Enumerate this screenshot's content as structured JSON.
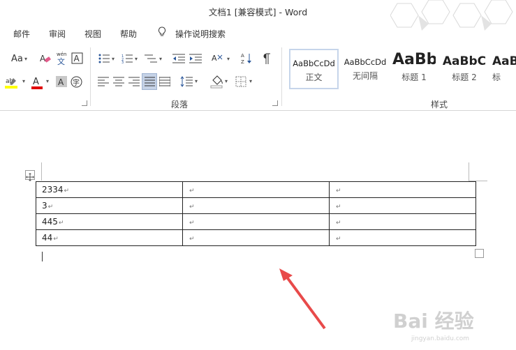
{
  "window": {
    "title": "文档1 [兼容模式]  -  Word"
  },
  "tabs": [
    {
      "label": "邮件"
    },
    {
      "label": "审阅"
    },
    {
      "label": "视图"
    },
    {
      "label": "帮助"
    }
  ],
  "tell_me": {
    "label": "操作说明搜索"
  },
  "ribbon": {
    "font_size_btn": "Aa",
    "paragraph_group": "段落",
    "styles_group": "样式",
    "styles": [
      {
        "sample": "AaBbCcDd",
        "name": "正文",
        "selected": true
      },
      {
        "sample": "AaBbCcDd",
        "name": "无间隔",
        "selected": false
      },
      {
        "sample": "AaBb",
        "name": "标题 1",
        "selected": false
      },
      {
        "sample": "AaBbC",
        "name": "标题 2",
        "selected": false
      },
      {
        "sample": "AaB",
        "name": "标",
        "selected": false
      }
    ]
  },
  "table": {
    "rows": [
      [
        "2334",
        "",
        ""
      ],
      [
        "3",
        "",
        ""
      ],
      [
        "445",
        "",
        ""
      ],
      [
        "44",
        "",
        ""
      ]
    ]
  },
  "watermark": {
    "text": "Bai 经验",
    "sub": "jingyan.baidu.com"
  },
  "colors": {
    "arrow": "#e84a4a",
    "accent": "#2b579a",
    "highlight": "#ffff00",
    "font_red": "#e00000"
  }
}
